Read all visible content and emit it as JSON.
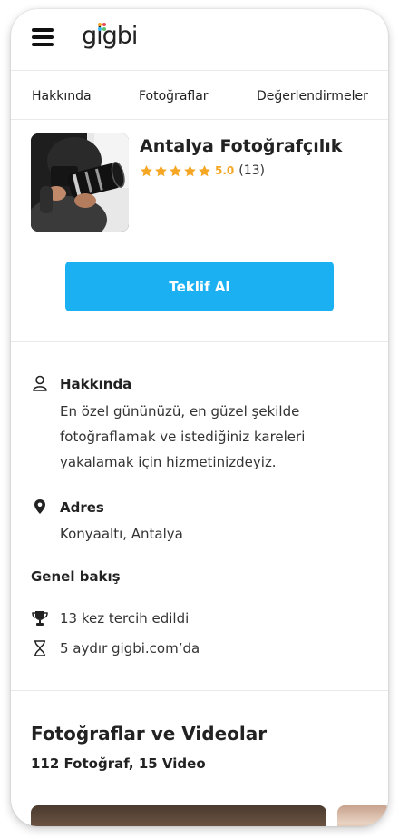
{
  "header": {
    "logo_text": "gigbi",
    "logo_dot_colors": [
      "#f5a623",
      "#e94b5a",
      "#3bb6f0",
      "#5cc46a"
    ]
  },
  "tabs": [
    {
      "label": "Hakkında"
    },
    {
      "label": "Fotoğraflar"
    },
    {
      "label": "Değerlendirmeler"
    }
  ],
  "profile": {
    "name": "Antalya Fotoğrafçılık",
    "rating_value": "5.0",
    "review_count": "(13)",
    "stars_filled": 5,
    "star_color": "#f5a623",
    "photo_icon": "photographer-with-camera"
  },
  "cta": {
    "label": "Teklif Al",
    "color": "#1bb0f2"
  },
  "about": {
    "icon": "user-icon",
    "title": "Hakkında",
    "lines": [
      "En özel gününüzü, en güzel şekilde",
      "fotoğraflamak ve istediğiniz kareleri",
      "yakalamak için hizmetinizdeyiz."
    ]
  },
  "address": {
    "icon": "location-pin-icon",
    "title": "Adres",
    "value": "Konyaaltı, Antalya"
  },
  "overview": {
    "title": "Genel bakış",
    "items": [
      {
        "icon": "trophy-icon",
        "text": "13 kez tercih edildi"
      },
      {
        "icon": "hourglass-icon",
        "text": "5 aydır gigbi.com’da"
      }
    ]
  },
  "media": {
    "title": "Fotoğraflar ve Videolar",
    "counts": "112 Fotoğraf, 15 Video"
  }
}
